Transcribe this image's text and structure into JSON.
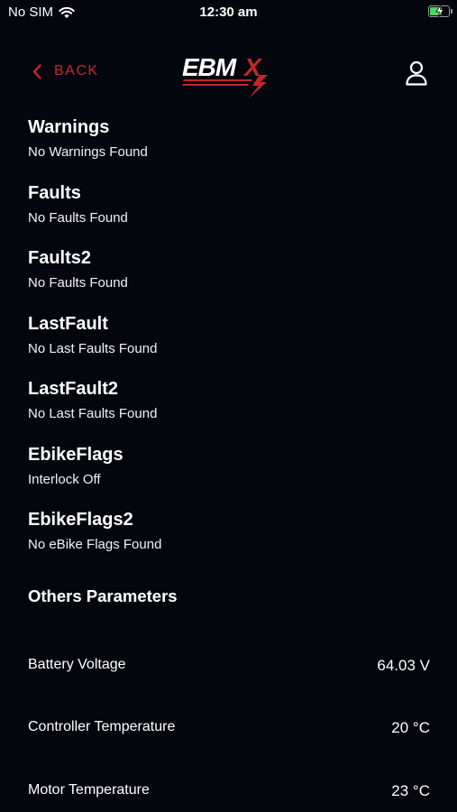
{
  "status_bar": {
    "carrier": "No SIM",
    "time": "12:30 am",
    "icons": [
      "wifi-icon",
      "battery-charging-icon"
    ]
  },
  "header": {
    "back_label": "BACK",
    "logo_text": "EBMX",
    "icons": [
      "chevron-left-icon",
      "user-icon"
    ]
  },
  "sections": [
    {
      "title": "Warnings",
      "text": "No Warnings Found"
    },
    {
      "title": "Faults",
      "text": "No Faults Found"
    },
    {
      "title": "Faults2",
      "text": "No Faults Found"
    },
    {
      "title": "LastFault",
      "text": "No Last Faults Found"
    },
    {
      "title": "LastFault2",
      "text": "No Last Faults Found"
    },
    {
      "title": "EbikeFlags",
      "text": "Interlock Off"
    },
    {
      "title": "EbikeFlags2",
      "text": "No eBike Flags Found"
    }
  ],
  "others": {
    "title": "Others Parameters",
    "params": [
      {
        "label": "Battery Voltage",
        "value": "64.03 V"
      },
      {
        "label": "Controller Temperature",
        "value": "20 °C"
      },
      {
        "label": "Motor Temperature",
        "value": "23 °C"
      }
    ]
  },
  "colors": {
    "background": "#04060d",
    "accent": "#c2282a",
    "text": "#ffffff",
    "battery": "#4fd65b"
  }
}
